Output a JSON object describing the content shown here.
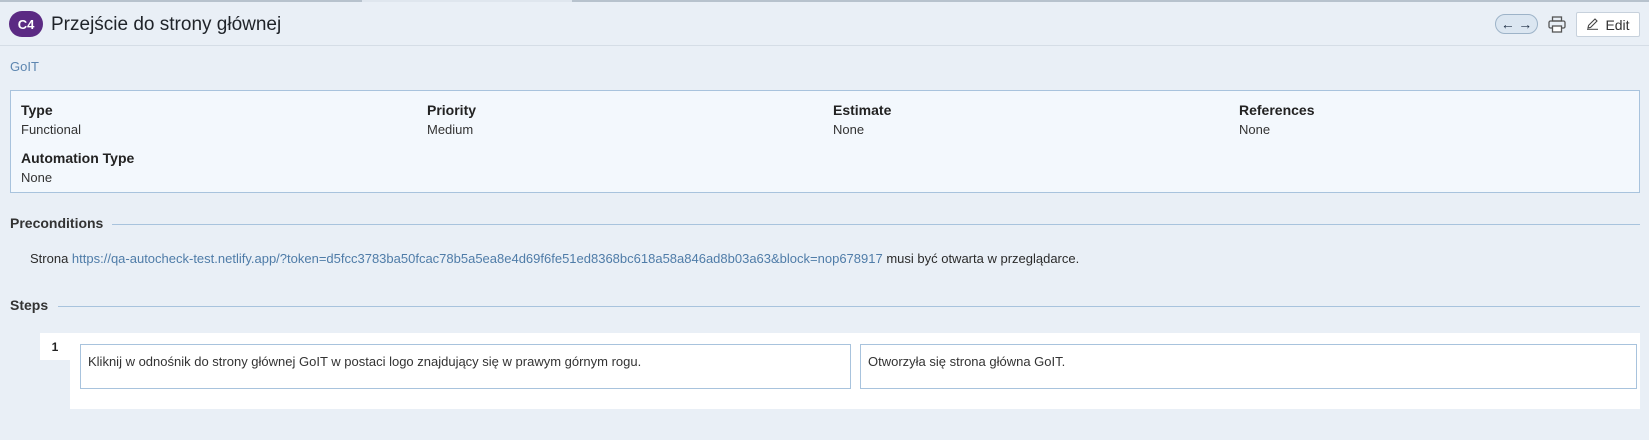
{
  "header": {
    "badge": "C4",
    "title": "Przejście do strony głównej",
    "prev_icon": "arrow-left-icon",
    "next_icon": "arrow-right-icon",
    "print_icon": "printer-icon",
    "edit_label": "Edit"
  },
  "project": "GoIT",
  "details": {
    "type": {
      "label": "Type",
      "value": "Functional"
    },
    "priority": {
      "label": "Priority",
      "value": "Medium"
    },
    "estimate": {
      "label": "Estimate",
      "value": "None"
    },
    "references": {
      "label": "References",
      "value": "None"
    },
    "automation": {
      "label": "Automation Type",
      "value": "None"
    }
  },
  "preconditions": {
    "title": "Preconditions",
    "prefix": "Strona ",
    "link": "https://qa-autocheck-test.netlify.app/?token=d5fcc3783ba50fcac78b5a5ea8e4d69f6fe51ed8368bc618a58a846ad8b03a63&block=nop678917",
    "suffix": " musi być otwarta w przeglądarce."
  },
  "steps": {
    "title": "Steps",
    "items": [
      {
        "number": "1",
        "action": "Kliknij w odnośnik do strony głównej GoIT w postaci logo znajdujący się w prawym górnym rogu.",
        "expected": "Otworzyła się strona główna GoIT."
      }
    ]
  }
}
